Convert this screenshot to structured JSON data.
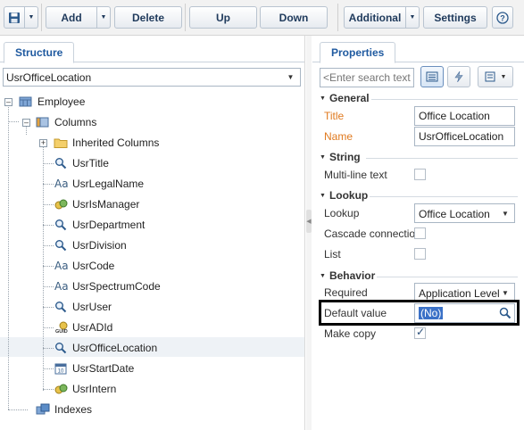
{
  "toolbar": {
    "add_label": "Add",
    "delete_label": "Delete",
    "up_label": "Up",
    "down_label": "Down",
    "additional_label": "Additional",
    "settings_label": "Settings",
    "help_icon": "question-mark"
  },
  "structure": {
    "tab_label": "Structure",
    "schema": "UsrOfficeLocation",
    "tree": {
      "root": "Employee",
      "columns": "Columns",
      "inherited": "Inherited Columns",
      "items": [
        {
          "label": "UsrTitle",
          "icon": "lookup-icon"
        },
        {
          "label": "UsrLegalName",
          "icon": "text-icon"
        },
        {
          "label": "UsrIsManager",
          "icon": "boolean-icon"
        },
        {
          "label": "UsrDepartment",
          "icon": "lookup-icon"
        },
        {
          "label": "UsrDivision",
          "icon": "lookup-icon"
        },
        {
          "label": "UsrCode",
          "icon": "text-icon"
        },
        {
          "label": "UsrSpectrumCode",
          "icon": "text-icon"
        },
        {
          "label": "UsrUser",
          "icon": "lookup-icon"
        },
        {
          "label": "UsrADId",
          "icon": "guid-icon"
        },
        {
          "label": "UsrOfficeLocation",
          "icon": "lookup-icon"
        },
        {
          "label": "UsrStartDate",
          "icon": "date-icon"
        },
        {
          "label": "UsrIntern",
          "icon": "boolean-icon"
        }
      ],
      "indexes": "Indexes",
      "selected": "UsrOfficeLocation"
    }
  },
  "properties": {
    "tab_label": "Properties",
    "search_placeholder": "<Enter search text>",
    "sections": {
      "general": "General",
      "string": "String",
      "lookup": "Lookup",
      "behavior": "Behavior"
    },
    "title_label": "Title",
    "title_value": "Office Location",
    "name_label": "Name",
    "name_value": "UsrOfficeLocation",
    "multiline_label": "Multi-line text",
    "multiline_checked": false,
    "lookup_label": "Lookup",
    "lookup_value": "Office Location",
    "cascade_label": "Cascade connection",
    "cascade_checked": false,
    "list_label": "List",
    "list_checked": false,
    "required_label": "Required",
    "required_value": "Application Level",
    "default_label": "Default value",
    "default_value": "(No)",
    "makecopy_label": "Make copy",
    "makecopy_checked": true
  },
  "colors": {
    "accent": "#1f5aa0",
    "label_orange": "#e07a1f",
    "highlight_border": "#000000",
    "selection": "#3b71c7"
  }
}
